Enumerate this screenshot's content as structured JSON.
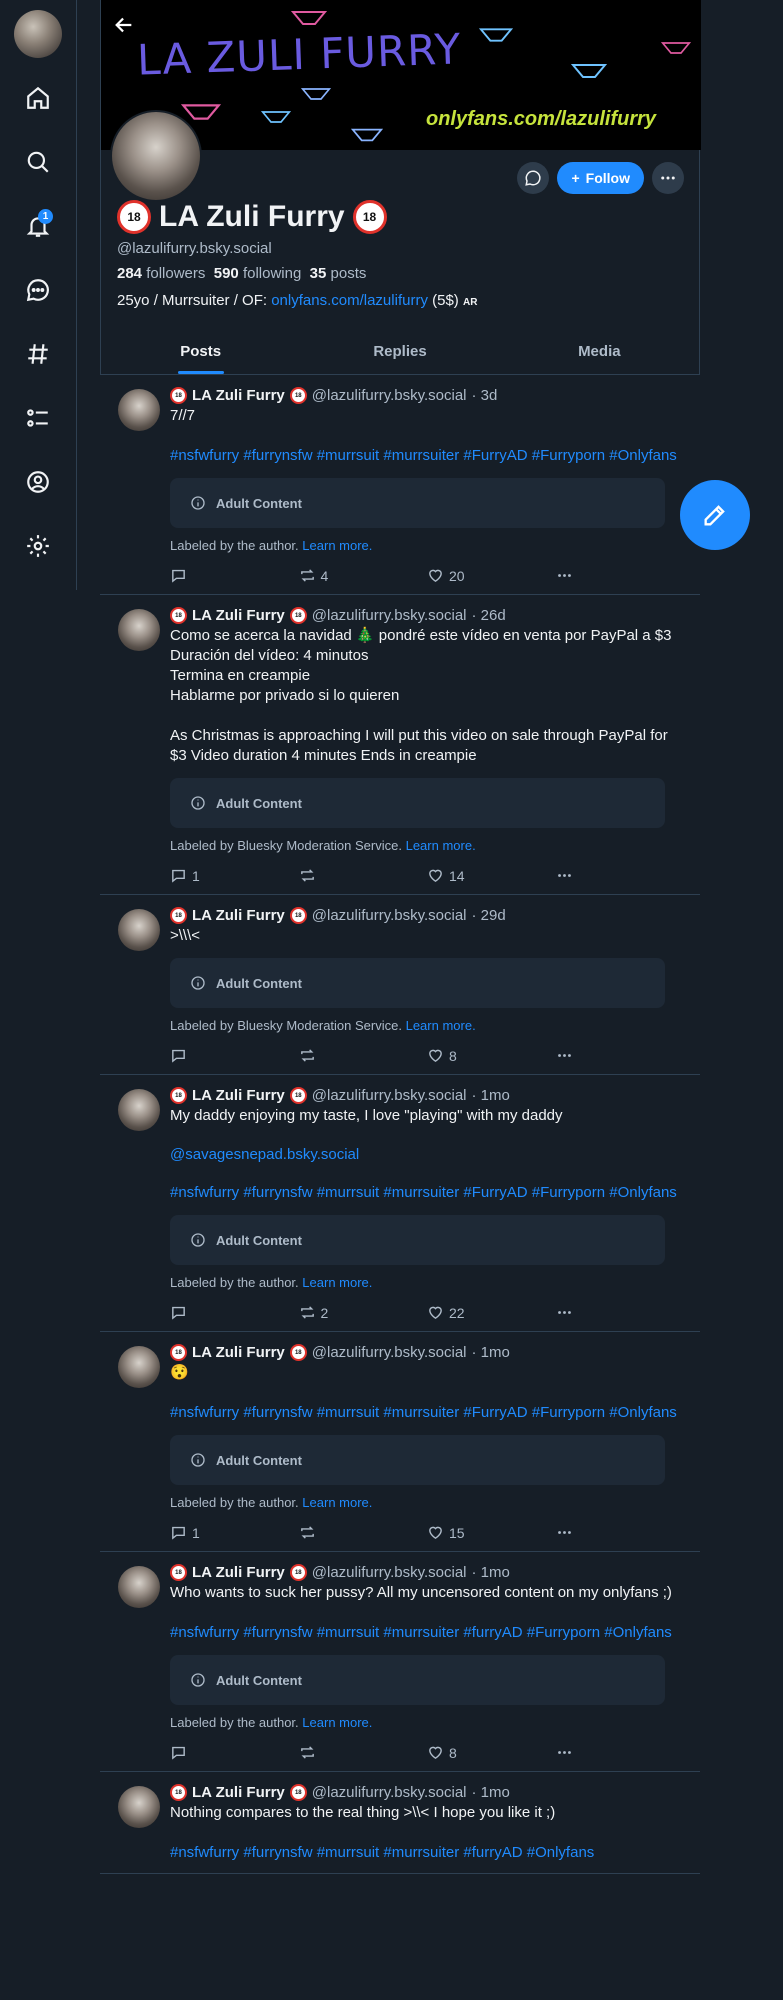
{
  "sidebar": {
    "notification_count": "1",
    "items": [
      "home",
      "search",
      "notifications",
      "chat",
      "feeds",
      "lists",
      "profile",
      "settings"
    ]
  },
  "banner": {
    "title": "LA ZULI FURRY",
    "url": "onlyfans.com/lazulifurry"
  },
  "profile": {
    "display_name": "LA Zuli Furry",
    "age_badge": "18",
    "handle": "@lazulifurry.bsky.social",
    "followers_count": "284",
    "followers_label": "followers",
    "following_count": "590",
    "following_label": "following",
    "posts_count": "35",
    "posts_label": "posts",
    "bio_prefix": "25yo / Murrsuiter / OF: ",
    "bio_link": "onlyfans.com/lazulifurry",
    "bio_suffix": " (5$)",
    "bio_tag": "AR",
    "follow_label": "Follow"
  },
  "tabs": [
    "Posts",
    "Replies",
    "Media"
  ],
  "adult_label": "Adult Content",
  "learn_more": "Learn more.",
  "posts": [
    {
      "name": "LA Zuli Furry",
      "handle": "@lazulifurry.bsky.social",
      "time": "· 3d",
      "text": "7//7",
      "mention": "",
      "tags": "#nsfwfurry #furrynsfw #murrsuit #murrsuiter #FurryAD #Furryporn #Onlyfans",
      "labeled_by": "Labeled by the author.",
      "replies": "",
      "reposts": "4",
      "likes": "20"
    },
    {
      "name": "LA Zuli Furry",
      "handle": "@lazulifurry.bsky.social",
      "time": "· 26d",
      "text": "Como se acerca la navidad 🎄 pondré este vídeo en venta por PayPal a $3\nDuración del vídeo: 4 minutos\nTermina en creampie\nHablarme por privado si lo quieren\n\nAs Christmas is approaching I will put this video on sale through PayPal for $3 Video duration 4 minutes Ends in creampie",
      "mention": "",
      "tags": "",
      "labeled_by": "Labeled by Bluesky Moderation Service.",
      "replies": "1",
      "reposts": "",
      "likes": "14"
    },
    {
      "name": "LA Zuli Furry",
      "handle": "@lazulifurry.bsky.social",
      "time": "· 29d",
      "text": ">\\\\\\<",
      "mention": "",
      "tags": "",
      "labeled_by": "Labeled by Bluesky Moderation Service.",
      "replies": "",
      "reposts": "",
      "likes": "8"
    },
    {
      "name": "LA Zuli Furry",
      "handle": "@lazulifurry.bsky.social",
      "time": "· 1mo",
      "text": "My daddy enjoying my taste, I love \"playing\" with my daddy",
      "mention": "@savagesnepad.bsky.social",
      "tags": "#nsfwfurry #furrynsfw #murrsuit #murrsuiter #FurryAD #Furryporn #Onlyfans",
      "labeled_by": "Labeled by the author.",
      "replies": "",
      "reposts": "2",
      "likes": "22"
    },
    {
      "name": "LA Zuli Furry",
      "handle": "@lazulifurry.bsky.social",
      "time": "· 1mo",
      "text": "😯",
      "mention": "",
      "tags": "#nsfwfurry #furrynsfw #murrsuit #murrsuiter #FurryAD #Furryporn #Onlyfans",
      "labeled_by": "Labeled by the author.",
      "replies": "1",
      "reposts": "",
      "likes": "15"
    },
    {
      "name": "LA Zuli Furry",
      "handle": "@lazulifurry.bsky.social",
      "time": "· 1mo",
      "text": "Who wants to suck her pussy? All my uncensored content on my onlyfans ;)",
      "mention": "",
      "tags": "#nsfwfurry #furrynsfw #murrsuit #murrsuiter #furryAD #Furryporn #Onlyfans",
      "labeled_by": "Labeled by the author.",
      "replies": "",
      "reposts": "",
      "likes": "8"
    },
    {
      "name": "LA Zuli Furry",
      "handle": "@lazulifurry.bsky.social",
      "time": "· 1mo",
      "text": "Nothing compares to the real thing >\\\\< I hope you like it ;)",
      "mention": "",
      "tags": "#nsfwfurry #furrynsfw #murrsuit #murrsuiter #furryAD #Onlyfans",
      "labeled_by": "",
      "replies": "",
      "reposts": "",
      "likes": ""
    }
  ]
}
